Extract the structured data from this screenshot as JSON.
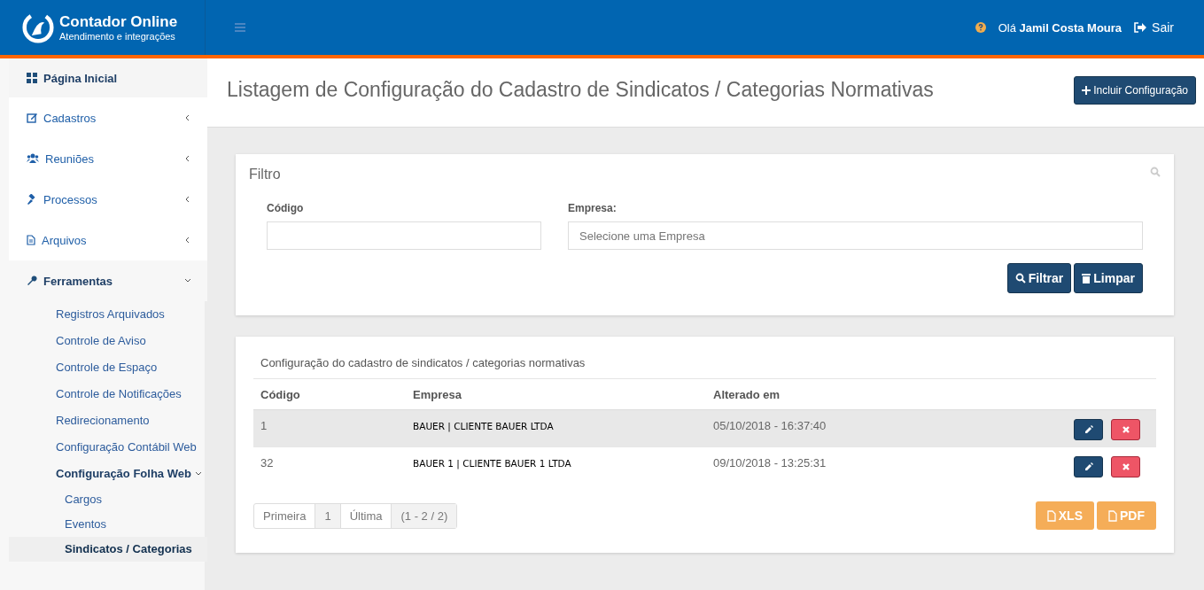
{
  "header": {
    "brand": "Contador Online",
    "tagline": "Atendimento e integrações",
    "greeting": "Olá",
    "user": "Jamil Costa Moura",
    "logout": "Sair"
  },
  "sidebar": {
    "items": [
      {
        "label": "Página Inicial",
        "selected": true
      },
      {
        "label": "Cadastros",
        "selected": false,
        "expanded": false
      },
      {
        "label": "Reuniões",
        "selected": false,
        "expanded": false
      },
      {
        "label": "Processos",
        "selected": false,
        "expanded": false
      },
      {
        "label": "Arquivos",
        "selected": false,
        "expanded": false
      },
      {
        "label": "Ferramentas",
        "selected": false,
        "expanded": true,
        "children": [
          {
            "label": "Registros Arquivados",
            "selected": false
          },
          {
            "label": "Controle de Aviso",
            "selected": false
          },
          {
            "label": "Controle de Espaço",
            "selected": false
          },
          {
            "label": "Controle de Notificações",
            "selected": false
          },
          {
            "label": "Redirecionamento",
            "selected": false
          },
          {
            "label": "Configuração Contábil Web",
            "selected": false
          },
          {
            "label": "Configuração Folha Web",
            "selected": false,
            "expanded": true,
            "children": [
              {
                "label": "Cargos",
                "selected": false
              },
              {
                "label": "Eventos",
                "selected": false
              },
              {
                "label": "Sindicatos / Categorias",
                "selected": true
              }
            ]
          }
        ]
      }
    ]
  },
  "page": {
    "title": "Listagem de Configuração do Cadastro de Sindicatos / Categorias Normativas",
    "add_button": "Incluir Configuração"
  },
  "filter": {
    "title": "Filtro",
    "fields": [
      {
        "label": "Código"
      },
      {
        "label": "Empresa:",
        "placeholder": "Selecione uma Empresa"
      }
    ],
    "buttons": [
      "Filtrar",
      "Limpar"
    ]
  },
  "table": {
    "caption": "Configuração do cadastro de sindicatos / categorias normativas",
    "columns": [
      "Código",
      "Empresa",
      "Alterado em"
    ],
    "rows": [
      {
        "codigo": "1",
        "empresa": "BAUER | CLIENTE BAUER LTDA",
        "alterado": "05/10/2018 - 16:37:40",
        "selected": true
      },
      {
        "codigo": "32",
        "empresa": "BAUER 1 | CLIENTE BAUER 1 LTDA",
        "alterado": "09/10/2018 - 13:25:31",
        "selected": false
      }
    ]
  },
  "pagination": {
    "first": "Primeira",
    "pages": [
      "1"
    ],
    "last": "Última",
    "summary": "(1 - 2 / 2)"
  },
  "exports": [
    "XLS",
    "PDF"
  ]
}
